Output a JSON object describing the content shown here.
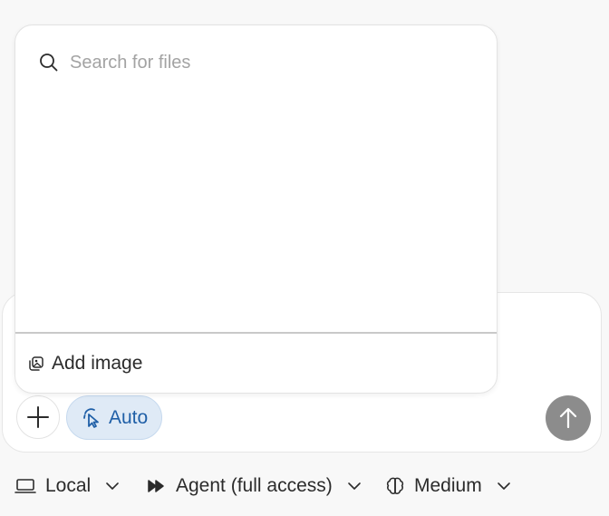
{
  "popup": {
    "search": {
      "placeholder": "Search for files",
      "value": "",
      "icon": "search-icon"
    },
    "add_image_label": "Add image"
  },
  "composer": {
    "plus_icon": "plus-icon",
    "auto_label": "Auto",
    "send_icon": "arrow-up-icon"
  },
  "toolbar": {
    "local_label": "Local",
    "agent_label": "Agent (full access)",
    "reasoning_label": "Medium"
  },
  "colors": {
    "accent_blue": "#1f5fa7",
    "pill_bg": "#dfeaf6",
    "send_bg": "#8c8c8c",
    "placeholder": "#a3a3a3"
  }
}
